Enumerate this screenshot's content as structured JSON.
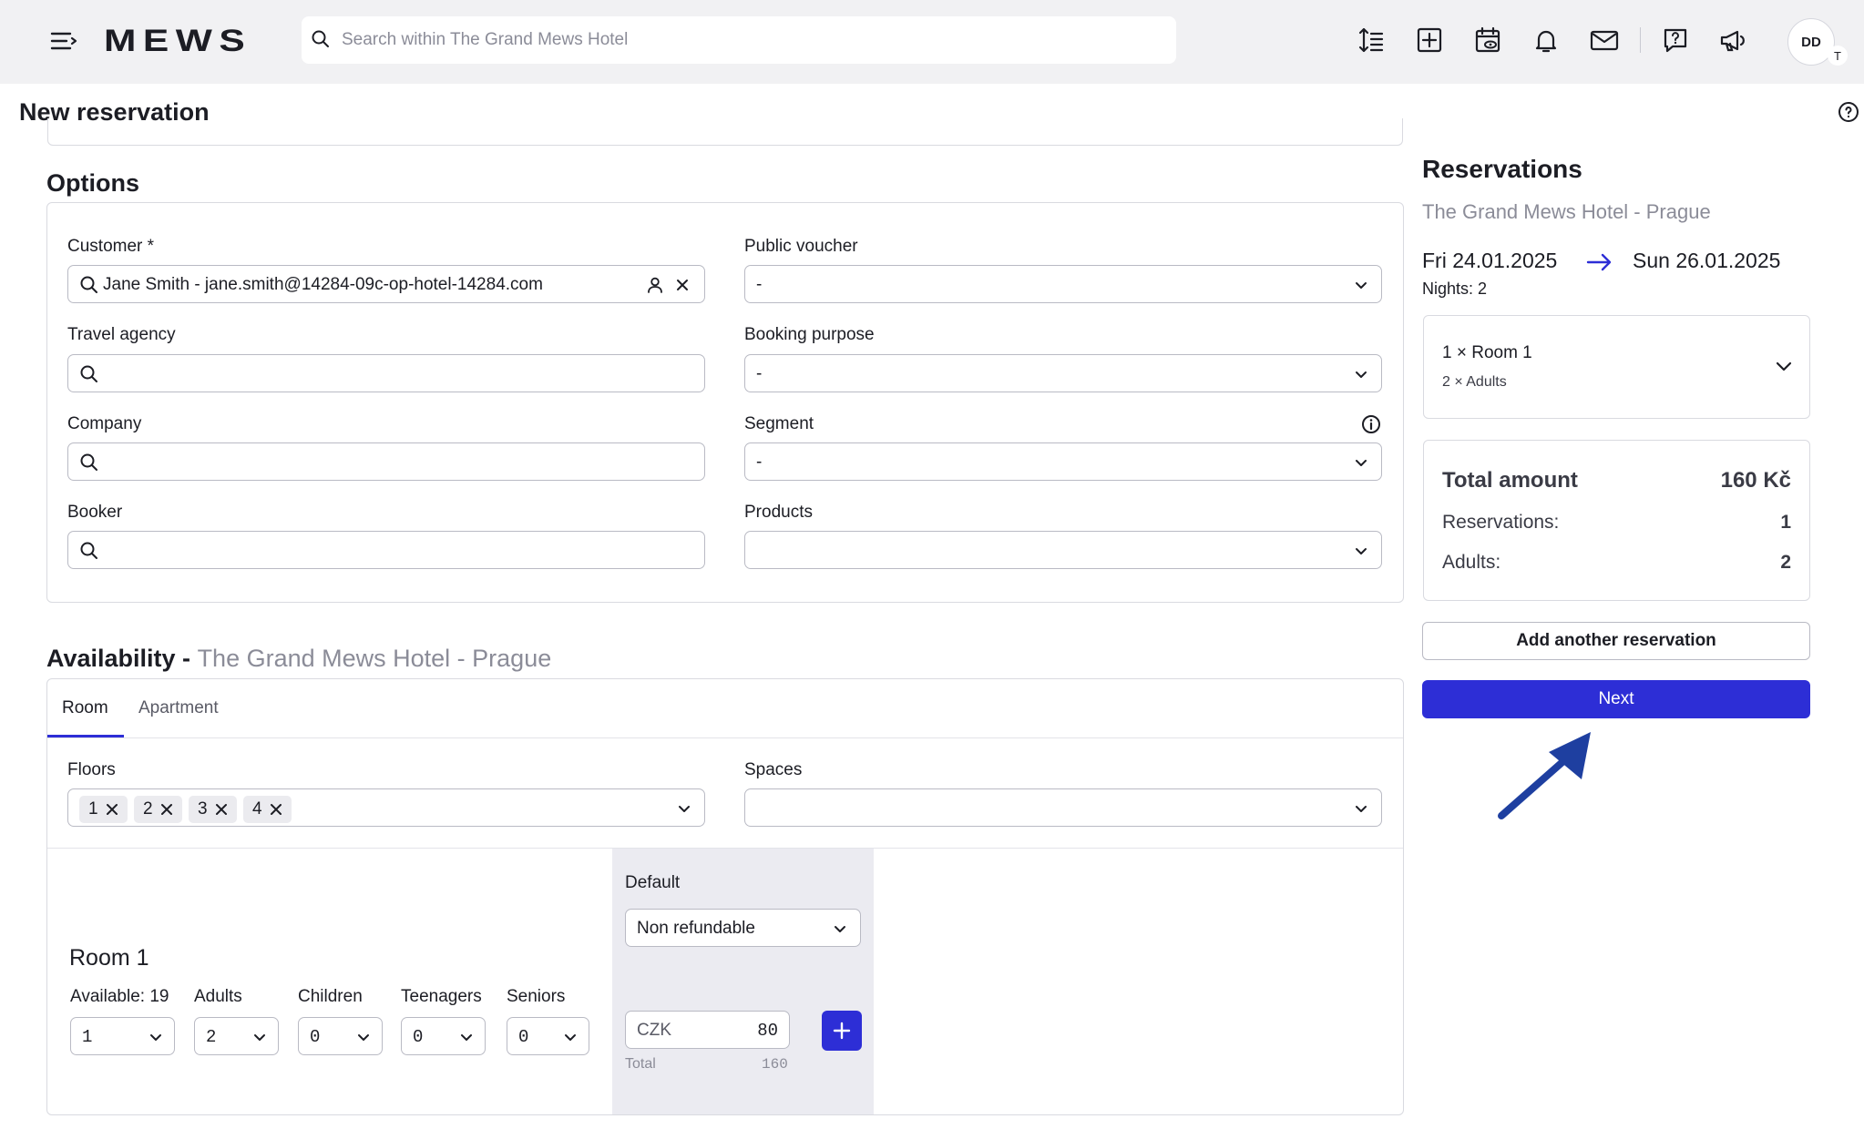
{
  "app": {
    "logo": "MEWS"
  },
  "search": {
    "placeholder": "Search within The Grand Mews Hotel"
  },
  "user": {
    "initials": "DD",
    "badge": "T"
  },
  "page": {
    "title": "New reservation"
  },
  "options": {
    "title": "Options",
    "customer": {
      "label": "Customer *",
      "value": "Jane Smith - jane.smith@14284-09c-op-hotel-14284.com"
    },
    "travel_agency": {
      "label": "Travel agency",
      "value": ""
    },
    "company": {
      "label": "Company",
      "value": ""
    },
    "booker": {
      "label": "Booker",
      "value": ""
    },
    "public_voucher": {
      "label": "Public voucher",
      "value": "-"
    },
    "booking_purpose": {
      "label": "Booking purpose",
      "value": "-"
    },
    "segment": {
      "label": "Segment",
      "value": "-"
    },
    "products": {
      "label": "Products",
      "value": ""
    }
  },
  "availability": {
    "title": "Availability -",
    "hotel": "The Grand Mews Hotel - Prague",
    "tabs": [
      "Room",
      "Apartment"
    ],
    "active_tab": "Room",
    "floors_label": "Floors",
    "floors": [
      "1",
      "2",
      "3",
      "4"
    ],
    "spaces_label": "Spaces",
    "spaces_value": "",
    "room": {
      "name": "Room 1",
      "available_label": "Available: 19",
      "adults_label": "Adults",
      "children_label": "Children",
      "teenagers_label": "Teenagers",
      "seniors_label": "Seniors",
      "qty": "1",
      "adults": "2",
      "children": "0",
      "teenagers": "0",
      "seniors": "0"
    },
    "rate": {
      "label": "Default",
      "selected": "Non refundable",
      "currency": "CZK",
      "price": "80",
      "total_label": "Total",
      "total": "160"
    }
  },
  "summary": {
    "title": "Reservations",
    "hotel": "The Grand Mews Hotel - Prague",
    "date_from": "Fri 24.01.2025",
    "date_to": "Sun 26.01.2025",
    "nights": "Nights: 2",
    "room_line": "1 × Room 1",
    "guests_line": "2 × Adults",
    "total_label": "Total amount",
    "total_value": "160 Kč",
    "reservations_label": "Reservations:",
    "reservations_value": "1",
    "adults_label": "Adults:",
    "adults_value": "2",
    "add_button": "Add another reservation",
    "next_button": "Next"
  },
  "colors": {
    "accent": "#2d2ed6",
    "arrow": "#1e3fa0",
    "muted": "#8b8c98"
  }
}
